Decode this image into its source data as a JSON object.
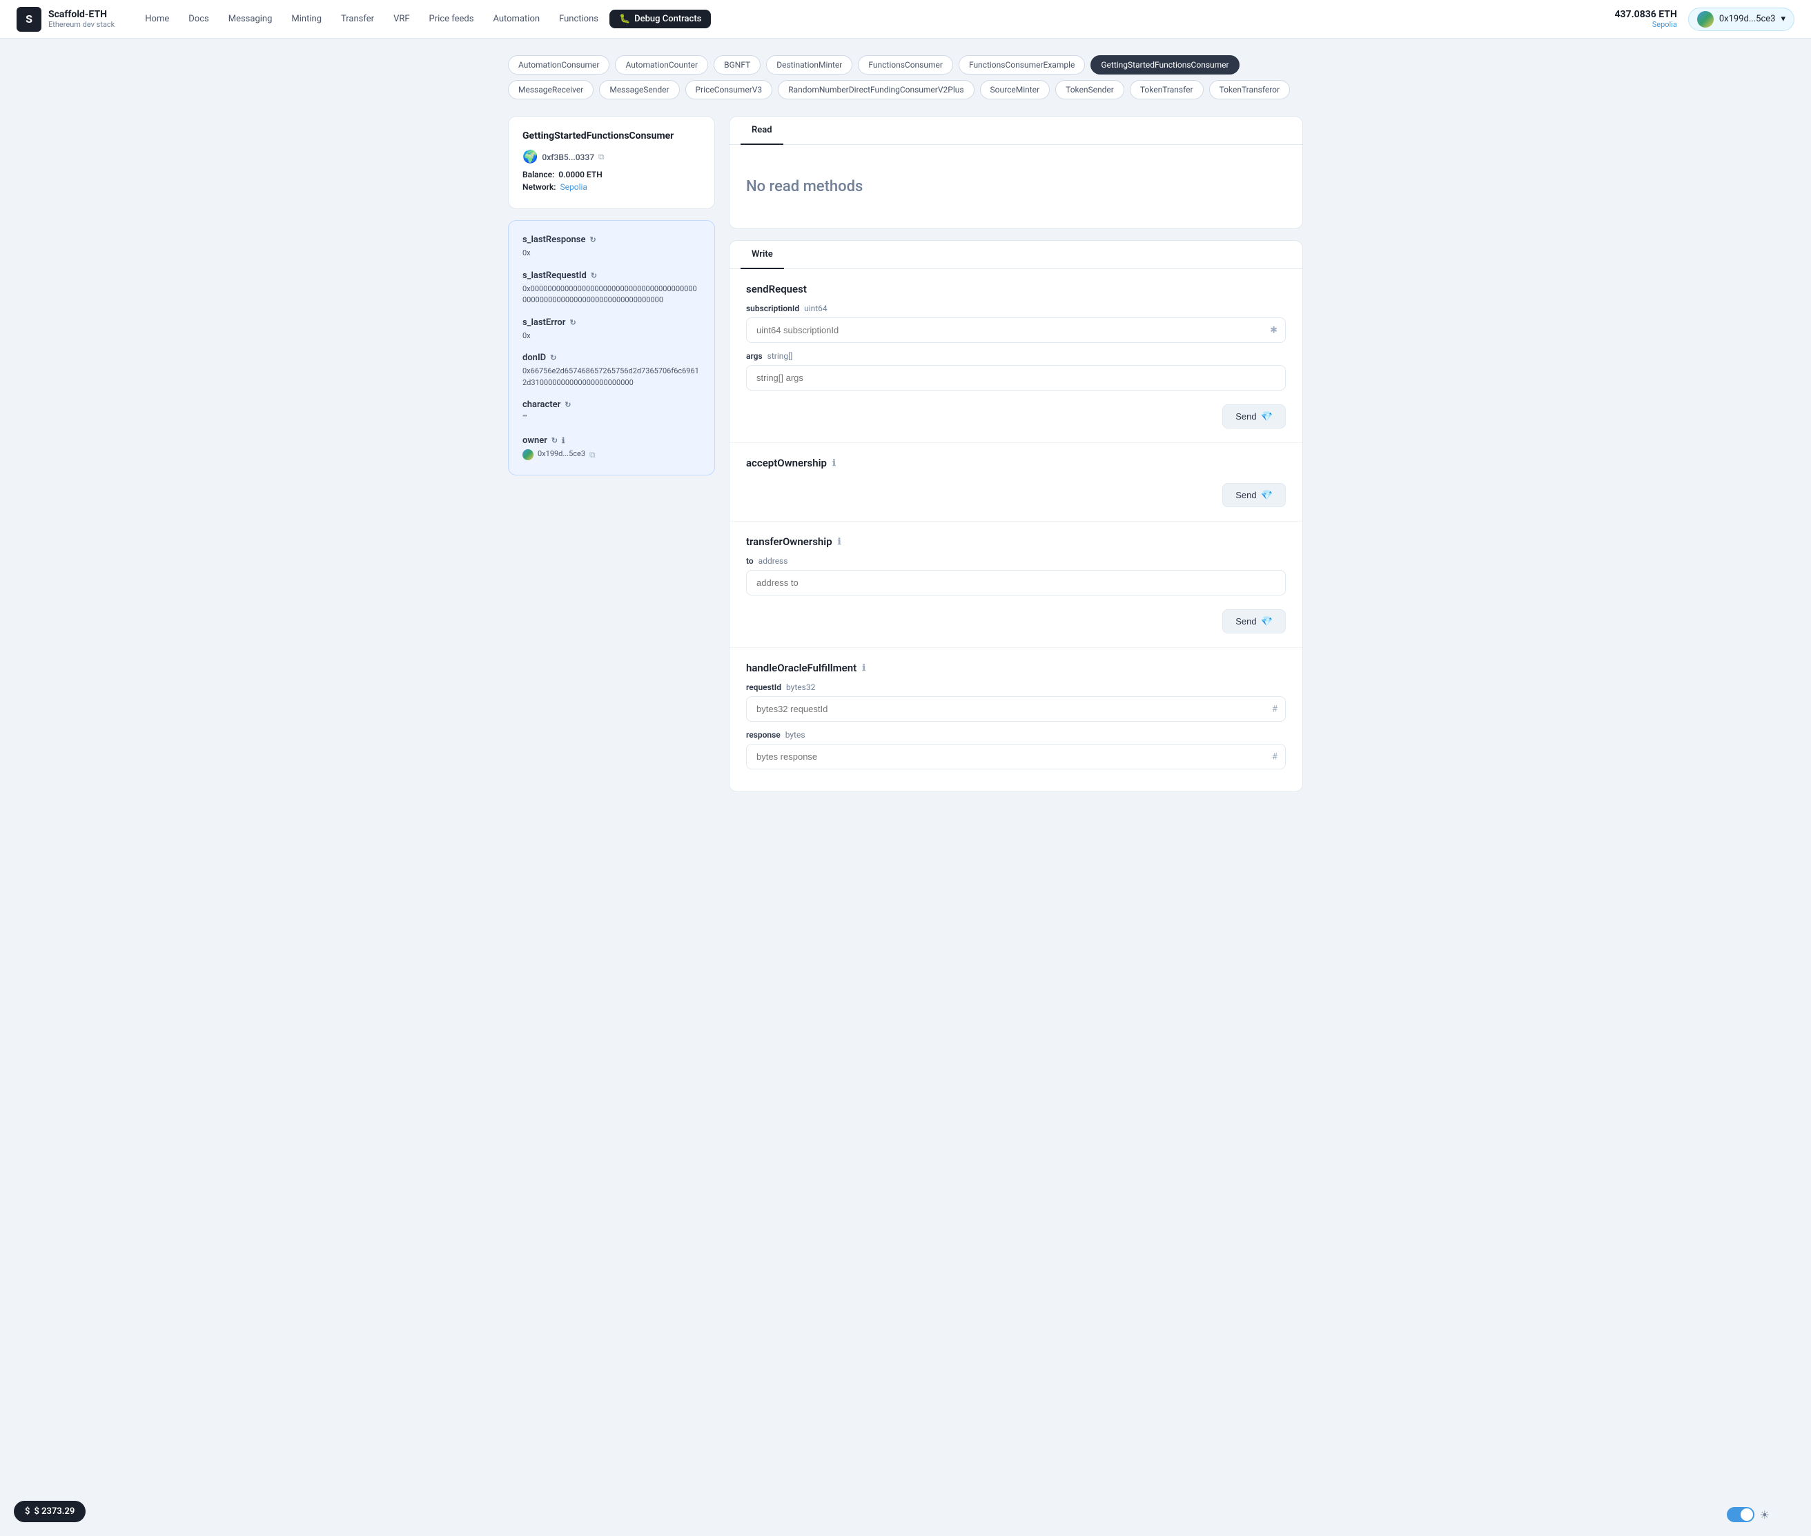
{
  "app": {
    "name": "Scaffold-ETH",
    "subtitle": "Ethereum dev stack"
  },
  "nav": {
    "items": [
      {
        "label": "Home",
        "active": false
      },
      {
        "label": "Docs",
        "active": false
      },
      {
        "label": "Messaging",
        "active": false
      },
      {
        "label": "Minting",
        "active": false
      },
      {
        "label": "Transfer",
        "active": false
      },
      {
        "label": "VRF",
        "active": false
      },
      {
        "label": "Price feeds",
        "active": false
      },
      {
        "label": "Automation",
        "active": false
      },
      {
        "label": "Functions",
        "active": false
      }
    ],
    "debug_label": "Debug Contracts"
  },
  "header": {
    "eth_amount": "437.0836 ETH",
    "network": "Sepolia",
    "wallet_address": "0x199d...5ce3"
  },
  "contract_tabs": [
    {
      "label": "AutomationConsumer",
      "active": false
    },
    {
      "label": "AutomationCounter",
      "active": false
    },
    {
      "label": "BGNFT",
      "active": false
    },
    {
      "label": "DestinationMinter",
      "active": false
    },
    {
      "label": "FunctionsConsumer",
      "active": false
    },
    {
      "label": "FunctionsConsumerExample",
      "active": false
    },
    {
      "label": "GettingStartedFunctionsConsumer",
      "active": true
    },
    {
      "label": "MessageReceiver",
      "active": false
    },
    {
      "label": "MessageSender",
      "active": false
    },
    {
      "label": "PriceConsumerV3",
      "active": false
    },
    {
      "label": "RandomNumberDirectFundingConsumerV2Plus",
      "active": false
    },
    {
      "label": "SourceMinter",
      "active": false
    },
    {
      "label": "TokenSender",
      "active": false
    },
    {
      "label": "TokenTransfer",
      "active": false
    },
    {
      "label": "TokenTransferor",
      "active": false
    }
  ],
  "contract_info": {
    "name": "GettingStartedFunctionsConsumer",
    "address": "0xf3B5...0337",
    "balance_label": "Balance:",
    "balance_value": "0.0000 ETH",
    "network_label": "Network:",
    "network_value": "Sepolia"
  },
  "state_vars": [
    {
      "name": "s_lastResponse",
      "has_refresh": true,
      "has_info": false,
      "value": "0x"
    },
    {
      "name": "s_lastRequestId",
      "has_refresh": true,
      "has_info": false,
      "value": "0x000000000000000000000000000000000000000000000000000000000000000000000000"
    },
    {
      "name": "s_lastError",
      "has_refresh": true,
      "has_info": false,
      "value": "0x"
    },
    {
      "name": "donID",
      "has_refresh": true,
      "has_info": false,
      "value": "0x66756e2d657468657265756d2d7365706f6c69612d310000000000000000000000"
    },
    {
      "name": "character",
      "has_refresh": true,
      "has_info": false,
      "value": "\"\""
    },
    {
      "name": "owner",
      "has_refresh": true,
      "has_info": true,
      "value": "0x199d...5ce3",
      "has_avatar": true
    }
  ],
  "read_section": {
    "tab_label": "Read",
    "no_methods_text": "No read methods"
  },
  "write_section": {
    "tab_label": "Write",
    "functions": [
      {
        "name": "sendRequest",
        "has_info": false,
        "params": [
          {
            "name": "subscriptionId",
            "type": "uint64",
            "placeholder": "uint64 subscriptionId",
            "suffix": "✱"
          },
          {
            "name": "args",
            "type": "string[]",
            "placeholder": "string[] args",
            "suffix": ""
          }
        ],
        "send_label": "Send"
      },
      {
        "name": "acceptOwnership",
        "has_info": true,
        "params": [],
        "send_label": "Send"
      },
      {
        "name": "transferOwnership",
        "has_info": true,
        "params": [
          {
            "name": "to",
            "type": "address",
            "placeholder": "address to",
            "suffix": ""
          }
        ],
        "send_label": "Send"
      },
      {
        "name": "handleOracleFulfillment",
        "has_info": true,
        "params": [
          {
            "name": "requestId",
            "type": "bytes32",
            "placeholder": "bytes32 requestId",
            "suffix": "#"
          },
          {
            "name": "response",
            "type": "bytes",
            "placeholder": "bytes response",
            "suffix": "#"
          }
        ],
        "send_label": "Send"
      }
    ]
  },
  "bottom_bar": {
    "price_label": "$ 2373.29"
  },
  "theme_toggle": {
    "is_dark": true
  }
}
